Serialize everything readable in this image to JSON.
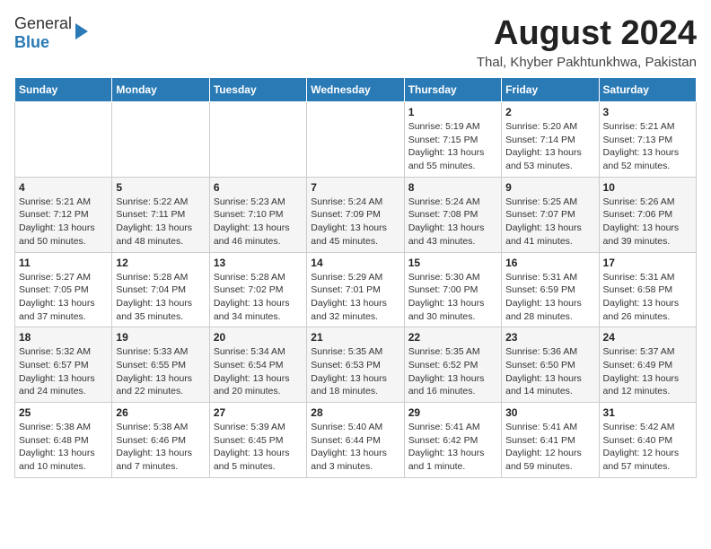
{
  "header": {
    "logo_general": "General",
    "logo_blue": "Blue",
    "month_year": "August 2024",
    "location": "Thal, Khyber Pakhtunkhwa, Pakistan"
  },
  "calendar": {
    "days_of_week": [
      "Sunday",
      "Monday",
      "Tuesday",
      "Wednesday",
      "Thursday",
      "Friday",
      "Saturday"
    ],
    "weeks": [
      [
        {
          "day": "",
          "info": ""
        },
        {
          "day": "",
          "info": ""
        },
        {
          "day": "",
          "info": ""
        },
        {
          "day": "",
          "info": ""
        },
        {
          "day": "1",
          "info": "Sunrise: 5:19 AM\nSunset: 7:15 PM\nDaylight: 13 hours\nand 55 minutes."
        },
        {
          "day": "2",
          "info": "Sunrise: 5:20 AM\nSunset: 7:14 PM\nDaylight: 13 hours\nand 53 minutes."
        },
        {
          "day": "3",
          "info": "Sunrise: 5:21 AM\nSunset: 7:13 PM\nDaylight: 13 hours\nand 52 minutes."
        }
      ],
      [
        {
          "day": "4",
          "info": "Sunrise: 5:21 AM\nSunset: 7:12 PM\nDaylight: 13 hours\nand 50 minutes."
        },
        {
          "day": "5",
          "info": "Sunrise: 5:22 AM\nSunset: 7:11 PM\nDaylight: 13 hours\nand 48 minutes."
        },
        {
          "day": "6",
          "info": "Sunrise: 5:23 AM\nSunset: 7:10 PM\nDaylight: 13 hours\nand 46 minutes."
        },
        {
          "day": "7",
          "info": "Sunrise: 5:24 AM\nSunset: 7:09 PM\nDaylight: 13 hours\nand 45 minutes."
        },
        {
          "day": "8",
          "info": "Sunrise: 5:24 AM\nSunset: 7:08 PM\nDaylight: 13 hours\nand 43 minutes."
        },
        {
          "day": "9",
          "info": "Sunrise: 5:25 AM\nSunset: 7:07 PM\nDaylight: 13 hours\nand 41 minutes."
        },
        {
          "day": "10",
          "info": "Sunrise: 5:26 AM\nSunset: 7:06 PM\nDaylight: 13 hours\nand 39 minutes."
        }
      ],
      [
        {
          "day": "11",
          "info": "Sunrise: 5:27 AM\nSunset: 7:05 PM\nDaylight: 13 hours\nand 37 minutes."
        },
        {
          "day": "12",
          "info": "Sunrise: 5:28 AM\nSunset: 7:04 PM\nDaylight: 13 hours\nand 35 minutes."
        },
        {
          "day": "13",
          "info": "Sunrise: 5:28 AM\nSunset: 7:02 PM\nDaylight: 13 hours\nand 34 minutes."
        },
        {
          "day": "14",
          "info": "Sunrise: 5:29 AM\nSunset: 7:01 PM\nDaylight: 13 hours\nand 32 minutes."
        },
        {
          "day": "15",
          "info": "Sunrise: 5:30 AM\nSunset: 7:00 PM\nDaylight: 13 hours\nand 30 minutes."
        },
        {
          "day": "16",
          "info": "Sunrise: 5:31 AM\nSunset: 6:59 PM\nDaylight: 13 hours\nand 28 minutes."
        },
        {
          "day": "17",
          "info": "Sunrise: 5:31 AM\nSunset: 6:58 PM\nDaylight: 13 hours\nand 26 minutes."
        }
      ],
      [
        {
          "day": "18",
          "info": "Sunrise: 5:32 AM\nSunset: 6:57 PM\nDaylight: 13 hours\nand 24 minutes."
        },
        {
          "day": "19",
          "info": "Sunrise: 5:33 AM\nSunset: 6:55 PM\nDaylight: 13 hours\nand 22 minutes."
        },
        {
          "day": "20",
          "info": "Sunrise: 5:34 AM\nSunset: 6:54 PM\nDaylight: 13 hours\nand 20 minutes."
        },
        {
          "day": "21",
          "info": "Sunrise: 5:35 AM\nSunset: 6:53 PM\nDaylight: 13 hours\nand 18 minutes."
        },
        {
          "day": "22",
          "info": "Sunrise: 5:35 AM\nSunset: 6:52 PM\nDaylight: 13 hours\nand 16 minutes."
        },
        {
          "day": "23",
          "info": "Sunrise: 5:36 AM\nSunset: 6:50 PM\nDaylight: 13 hours\nand 14 minutes."
        },
        {
          "day": "24",
          "info": "Sunrise: 5:37 AM\nSunset: 6:49 PM\nDaylight: 13 hours\nand 12 minutes."
        }
      ],
      [
        {
          "day": "25",
          "info": "Sunrise: 5:38 AM\nSunset: 6:48 PM\nDaylight: 13 hours\nand 10 minutes."
        },
        {
          "day": "26",
          "info": "Sunrise: 5:38 AM\nSunset: 6:46 PM\nDaylight: 13 hours\nand 7 minutes."
        },
        {
          "day": "27",
          "info": "Sunrise: 5:39 AM\nSunset: 6:45 PM\nDaylight: 13 hours\nand 5 minutes."
        },
        {
          "day": "28",
          "info": "Sunrise: 5:40 AM\nSunset: 6:44 PM\nDaylight: 13 hours\nand 3 minutes."
        },
        {
          "day": "29",
          "info": "Sunrise: 5:41 AM\nSunset: 6:42 PM\nDaylight: 13 hours\nand 1 minute."
        },
        {
          "day": "30",
          "info": "Sunrise: 5:41 AM\nSunset: 6:41 PM\nDaylight: 12 hours\nand 59 minutes."
        },
        {
          "day": "31",
          "info": "Sunrise: 5:42 AM\nSunset: 6:40 PM\nDaylight: 12 hours\nand 57 minutes."
        }
      ]
    ]
  }
}
